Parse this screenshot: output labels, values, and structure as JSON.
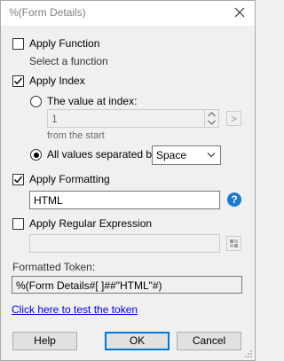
{
  "window": {
    "title": "%(Form Details)"
  },
  "apply_function": {
    "label": "Apply Function",
    "checked": false,
    "hint": "Select a function"
  },
  "apply_index": {
    "label": "Apply Index",
    "checked": true,
    "value_at_index_label": "The value at index:",
    "index_value": "1",
    "from_label": "from the  start",
    "more_button": ">",
    "all_values_label": "All values separated by:",
    "separator_value": "Space"
  },
  "apply_formatting": {
    "label": "Apply Formatting",
    "checked": true,
    "value": "HTML",
    "help_glyph": "?"
  },
  "apply_regex": {
    "label": "Apply Regular Expression",
    "checked": false,
    "value": ""
  },
  "formatted_token": {
    "label": "Formatted Token:",
    "value": "%(Form Details#[ ]##\"HTML\"#)"
  },
  "test_link": "Click here to test the token",
  "buttons": {
    "help": "Help",
    "ok": "OK",
    "cancel": "Cancel"
  }
}
